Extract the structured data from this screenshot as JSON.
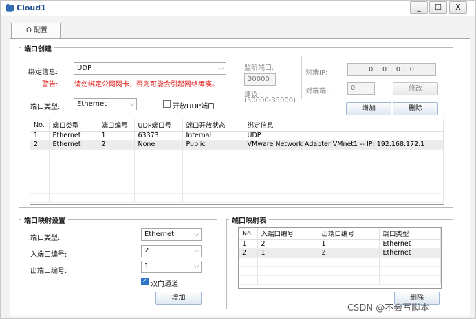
{
  "window": {
    "title": "Cloud1",
    "minimize_label": "_",
    "maximize_label": "☐",
    "close_label": "X"
  },
  "tabs": [
    {
      "label": "IO 配置"
    }
  ],
  "port_creation": {
    "legend": "端口创建",
    "binding_label": "绑定信息:",
    "binding_value": "UDP",
    "warning_label": "警告:",
    "warning_text": "请勿绑定公网网卡，否则可能会引起网络瘫痪。",
    "port_type_label": "端口类型:",
    "port_type_value": "Ethernet",
    "open_udp_label": "开放UDP端口",
    "open_udp_checked": false,
    "listen_port_label": "监听端口:",
    "listen_port_value": "30000",
    "suggest_label": "建议:",
    "suggest_range": "(30000-35000)",
    "peer_ip_label": "对端IP:",
    "peer_ip_value": "0 . 0 . 0 . 0",
    "peer_port_label": "对端端口:",
    "peer_port_value": "0",
    "modify_label": "修改",
    "add_label": "增加",
    "delete_label": "删除",
    "table": {
      "headers": [
        "No.",
        "端口类型",
        "端口编号",
        "UDP端口号",
        "端口开放状态",
        "绑定信息"
      ],
      "rows": [
        [
          "1",
          "Ethernet",
          "1",
          "63373",
          "Internal",
          "UDP"
        ],
        [
          "2",
          "Ethernet",
          "2",
          "None",
          "Public",
          "VMware Network Adapter VMnet1 -- IP: 192.168.172.1"
        ]
      ],
      "selected_row": 1
    }
  },
  "port_mapping_settings": {
    "legend": "端口映射设置",
    "port_type_label": "端口类型:",
    "port_type_value": "Ethernet",
    "in_port_label": "入端口编号:",
    "in_port_value": "2",
    "out_port_label": "出端口编号:",
    "out_port_value": "1",
    "bidirectional_label": "双向通道",
    "bidirectional_checked": true,
    "add_label": "增加"
  },
  "port_mapping_table": {
    "legend": "端口映射表",
    "headers": [
      "No.",
      "入端口编号",
      "出端口编号",
      "端口类型"
    ],
    "rows": [
      [
        "1",
        "2",
        "1",
        "Ethernet"
      ],
      [
        "2",
        "1",
        "2",
        "Ethernet"
      ]
    ],
    "selected_row": 1,
    "delete_label": "删除"
  },
  "watermark": "CSDN @不会写脚本",
  "icons": {
    "app": "cloud-app-icon",
    "chevron": "chevron-down-icon",
    "check": "checkmark-icon"
  }
}
